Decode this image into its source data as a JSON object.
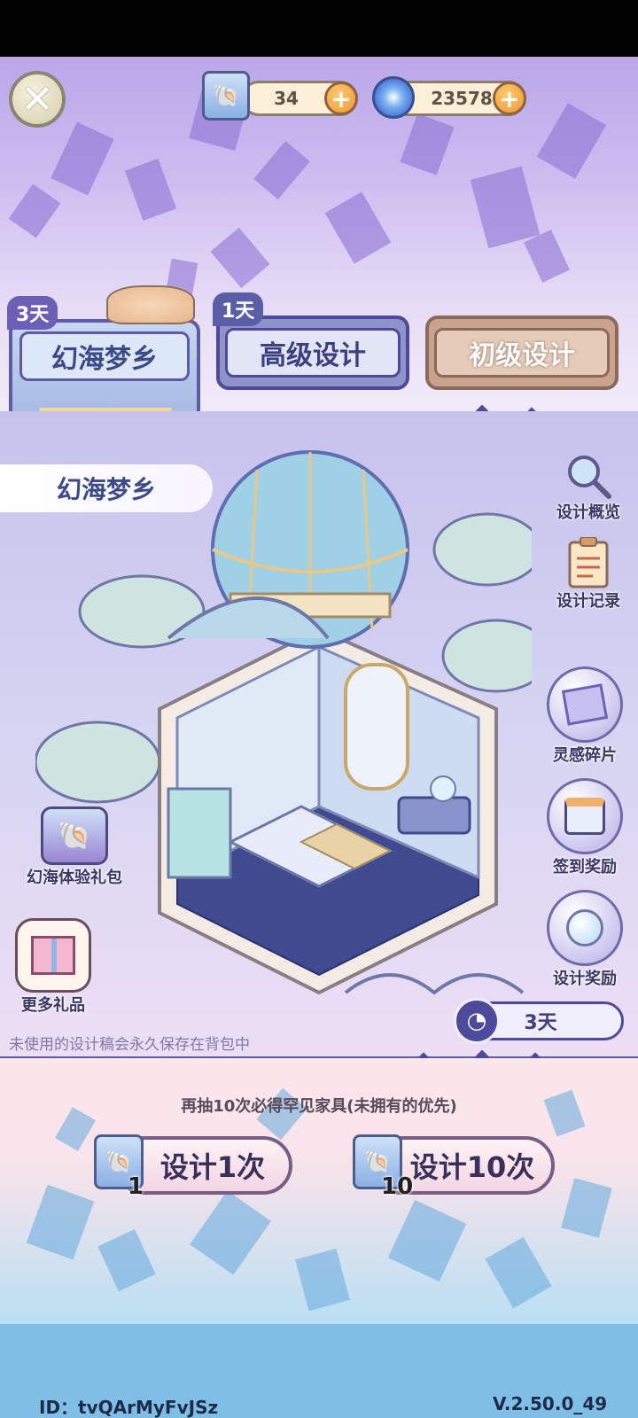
{
  "topbar": {
    "close_icon": "close-x-icon",
    "design_tickets": "34",
    "currency": "23578",
    "plus_icon": "plus-icon"
  },
  "tabs": [
    {
      "badge": "3天",
      "label": "幻海梦乡",
      "selected": true
    },
    {
      "badge": "1天",
      "label": "高级设计",
      "selected": false
    },
    {
      "badge": "",
      "label": "初级设计",
      "selected": false
    }
  ],
  "banner": {
    "title": "幻海梦乡"
  },
  "side_menu": [
    {
      "label": "设计概览",
      "icon": "magnifier-icon"
    },
    {
      "label": "设计记录",
      "icon": "clipboard-icon"
    },
    {
      "label": "灵感碎片",
      "icon": "blueprint-icon"
    },
    {
      "label": "签到奖励",
      "icon": "calendar-icon"
    },
    {
      "label": "设计奖励",
      "icon": "crystal-ball-icon"
    }
  ],
  "left_menu": [
    {
      "label": "幻海体验礼包",
      "icon": "gift-pack-icon"
    },
    {
      "label": "更多礼品",
      "icon": "gift-box-icon"
    }
  ],
  "timer": {
    "value": "3天",
    "icon": "clock-icon"
  },
  "notice": "未使用的设计稿会永久保存在背包中",
  "guarantee": "再抽10次必得罕见家具(未拥有的优先)",
  "draw_buttons": [
    {
      "label": "设计1次",
      "cost": "1"
    },
    {
      "label": "设计10次",
      "cost": "10"
    }
  ],
  "footer": {
    "player_id": "ID：tvQArMyFvJSz",
    "version": "V.2.50.0_49"
  },
  "colors": {
    "accent_purple": "#5d5aa6",
    "tab_selected": "#aebfe6",
    "tab_advanced": "#8f93c9",
    "tab_basic": "#c9a38e"
  }
}
